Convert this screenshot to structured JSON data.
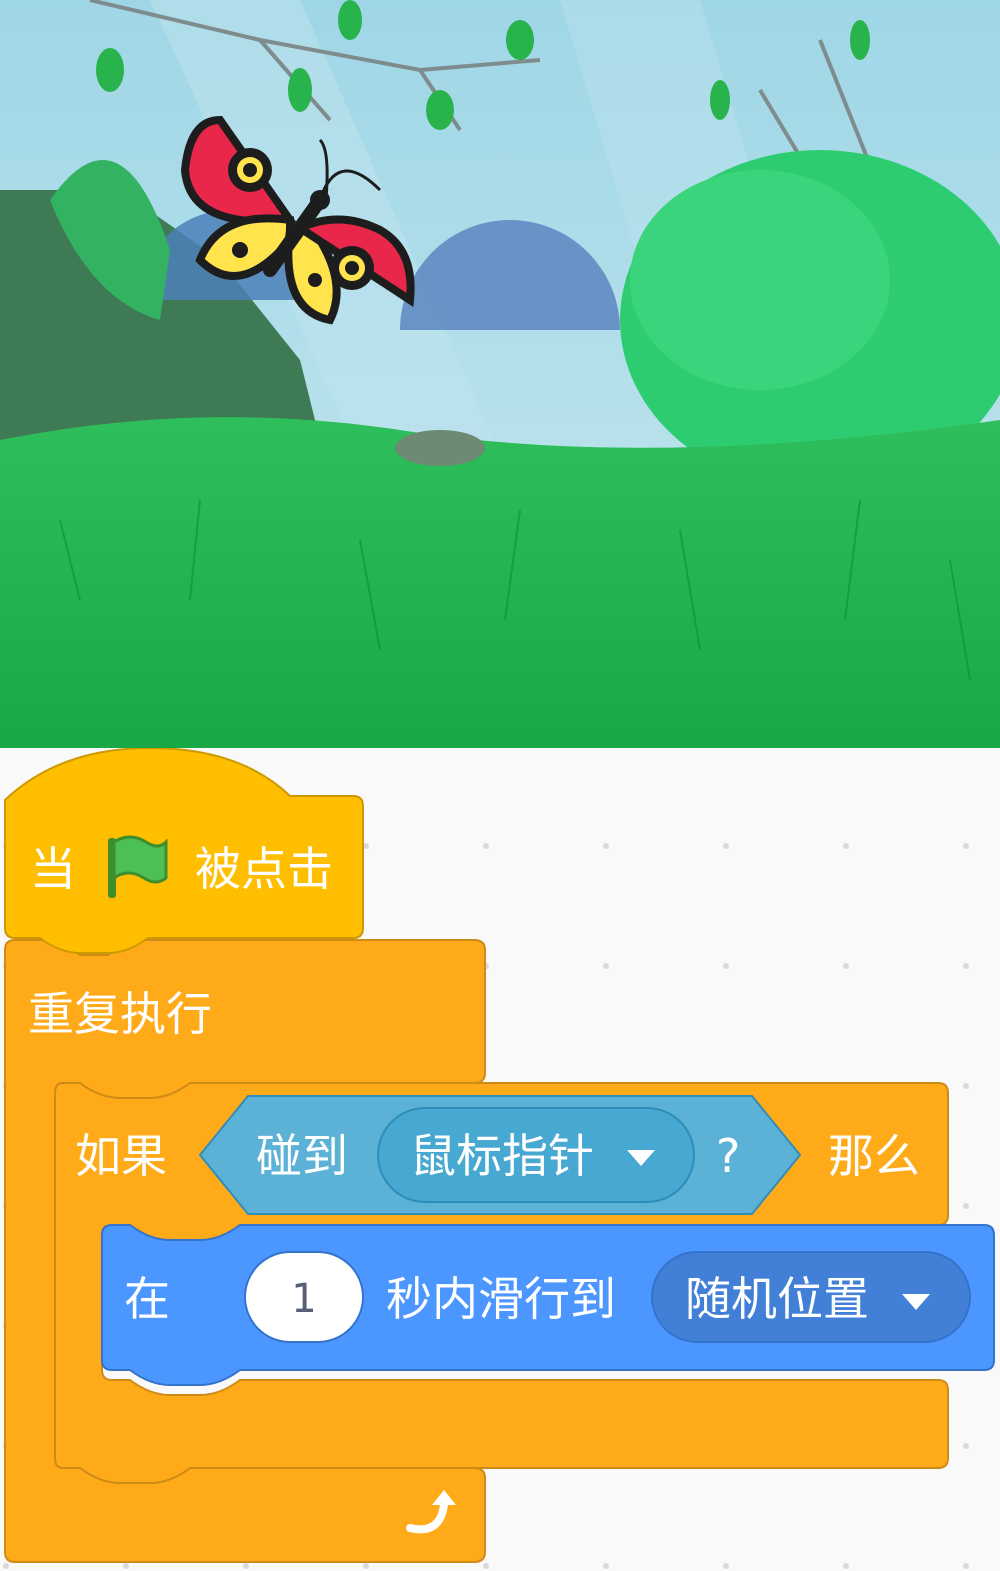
{
  "stage": {
    "backdrop_icon": "meadow-backdrop",
    "sprite_icon": "butterfly-icon"
  },
  "script": {
    "hat": {
      "text_before": "当",
      "flag_icon": "green-flag-icon",
      "text_after": "被点击"
    },
    "forever": {
      "label": "重复执行",
      "loop_arrow_icon": "loop-arrow-icon"
    },
    "if_block": {
      "label_if": "如果",
      "label_then": "那么",
      "condition": {
        "label": "碰到",
        "target": "鼠标指针",
        "question": "?"
      }
    },
    "glide": {
      "label_in": "在",
      "seconds": "1",
      "label_mid": "秒内滑行到",
      "target": "随机位置"
    }
  },
  "colors": {
    "events": "#ffbf00",
    "control": "#ffab19",
    "motion": "#4c97ff",
    "sensing": "#5cb1d6",
    "workspace_bg": "#f9f9f9"
  }
}
